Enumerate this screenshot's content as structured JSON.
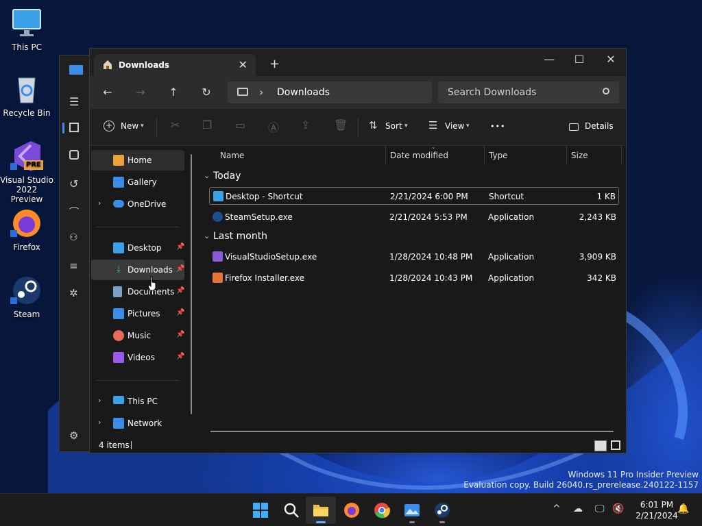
{
  "desktop": {
    "icons": [
      {
        "label": "This PC"
      },
      {
        "label": "Recycle Bin"
      },
      {
        "label": "Visual Studio 2022 Preview",
        "badge": "PRE"
      },
      {
        "label": "Firefox"
      },
      {
        "label": "Steam"
      }
    ],
    "watermark": {
      "line1": "Windows 11 Pro Insider Preview",
      "line2": "Evaluation copy. Build 26040.rs_prerelease.240122-1157"
    }
  },
  "window": {
    "tab": {
      "title": "Downloads",
      "close": "✕"
    },
    "newtab": "+",
    "controls": {
      "minimize": "—",
      "maximize": "☐",
      "close": "✕"
    },
    "nav": {
      "back": "←",
      "forward": "→",
      "up": "↑",
      "refresh": "↻"
    },
    "address": {
      "separator": "›",
      "location": "Downloads"
    },
    "search": {
      "placeholder": "Search Downloads"
    },
    "toolbar": {
      "new_label": "New",
      "sort_label": "Sort",
      "view_label": "View",
      "more_label": "•••",
      "details_label": "Details"
    },
    "sidebar": {
      "items": [
        {
          "label": "Home",
          "color": "#e8a33a"
        },
        {
          "label": "Gallery",
          "color": "#3a8ee8"
        },
        {
          "label": "OneDrive",
          "color": "#3a8ee8",
          "expand": "›"
        },
        {
          "label": "Desktop",
          "color": "#3aa0e8",
          "pin": "📌"
        },
        {
          "label": "Downloads",
          "color": "#3ab86a",
          "pin": "📌"
        },
        {
          "label": "Documents",
          "color": "#7aa0c8",
          "pin": "📌"
        },
        {
          "label": "Pictures",
          "color": "#3a8ee8",
          "pin": "📌"
        },
        {
          "label": "Music",
          "color": "#e86a5a",
          "pin": "📌"
        },
        {
          "label": "Videos",
          "color": "#9a5ae8",
          "pin": "📌"
        },
        {
          "label": "This PC",
          "color": "#3aa0e8",
          "expand": "›"
        },
        {
          "label": "Network",
          "color": "#3a8ee8",
          "expand": "›"
        }
      ]
    },
    "columns": {
      "name": "Name",
      "date": "Date modified",
      "type": "Type",
      "size": "Size"
    },
    "groups": [
      {
        "label": "Today",
        "chevron": "⌄",
        "files": [
          {
            "name": "Desktop - Shortcut",
            "date": "2/21/2024 6:00 PM",
            "type": "Shortcut",
            "size": "1 KB",
            "color": "#3aa0e8"
          },
          {
            "name": "SteamSetup.exe",
            "date": "2/21/2024 5:53 PM",
            "type": "Application",
            "size": "2,243 KB",
            "color": "#1b4f8a"
          }
        ]
      },
      {
        "label": "Last month",
        "chevron": "⌄",
        "files": [
          {
            "name": "VisualStudioSetup.exe",
            "date": "1/28/2024 10:48 PM",
            "type": "Application",
            "size": "3,909 KB",
            "color": "#8a5ad8"
          },
          {
            "name": "Firefox Installer.exe",
            "date": "1/28/2024 10:43 PM",
            "type": "Application",
            "size": "342 KB",
            "color": "#e8733a"
          }
        ]
      }
    ],
    "status": {
      "count": "4 items"
    }
  },
  "taskbar": {
    "clock": {
      "time": "6:01 PM",
      "date": "2/21/2024"
    },
    "tray_chevron": "^"
  }
}
